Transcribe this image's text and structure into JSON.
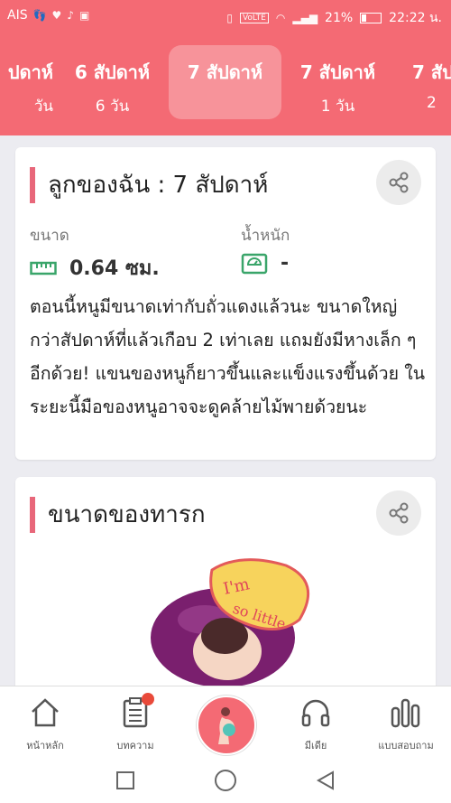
{
  "status_bar": {
    "carrier": "AIS",
    "battery": "21%",
    "time": "22:22 น."
  },
  "weeks": [
    {
      "week": "ปดาห์",
      "days": "วัน"
    },
    {
      "week": "6 สัปดาห์",
      "days": "6 วัน"
    },
    {
      "week": "7 สัปดาห์",
      "days": ""
    },
    {
      "week": "7 สัปดาห์",
      "days": "1 วัน"
    },
    {
      "week": "7 สัป",
      "days": "2"
    }
  ],
  "baby_card": {
    "title": "ลูกของฉัน : 7 สัปดาห์",
    "size_label": "ขนาด",
    "size_value": "0.64 ซม.",
    "weight_label": "น้ำหนัก",
    "weight_value": "-",
    "description": "ตอนนี้หนูมีขนาดเท่ากับถั่วแดงแล้วนะ ขนาดใหญ่กว่าสัปดาห์ที่แล้วเกือบ 2 เท่าเลย แถมยังมีหางเล็ก ๆ อีกด้วย! แขนของหนูก็ยาวขึ้นและแข็งแรงขึ้นด้วย ในระยะนี้มือของหนูอาจจะดูคล้ายไม้พายด้วยนะ"
  },
  "size_card": {
    "title": "ขนาดของทารก",
    "bubble_line1": "I'm",
    "bubble_line2": "so little"
  },
  "bottom_nav": {
    "home": "หน้าหลัก",
    "articles": "บทความ",
    "media": "มีเดีย",
    "survey": "แบบสอบถาม"
  },
  "colors": {
    "brand": "#f46a74",
    "accent_bar": "#e8677a",
    "icon_green": "#3aa56a",
    "bean_purple": "#7a1f6e"
  }
}
